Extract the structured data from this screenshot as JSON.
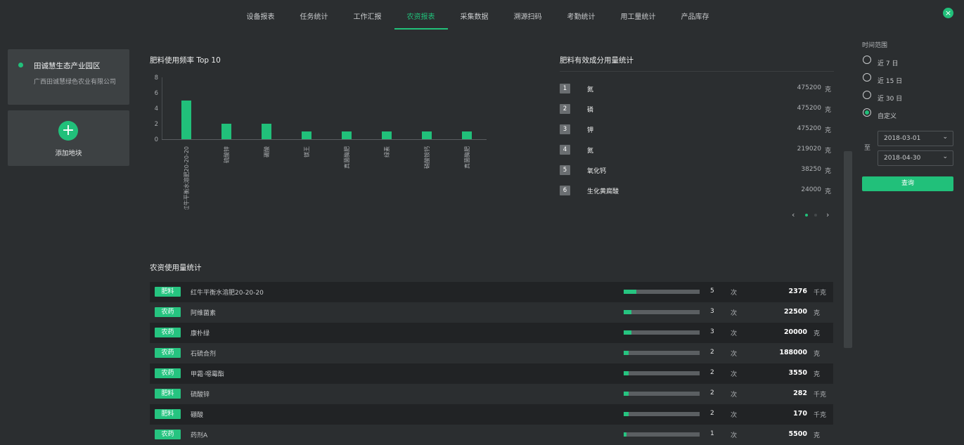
{
  "nav": {
    "tabs": [
      {
        "label": "设备报表"
      },
      {
        "label": "任务统计"
      },
      {
        "label": "工作汇报"
      },
      {
        "label": "农资报表"
      },
      {
        "label": "采集数据"
      },
      {
        "label": "溯源扫码"
      },
      {
        "label": "考勤统计"
      },
      {
        "label": "用工量统计"
      },
      {
        "label": "产品库存"
      }
    ],
    "active_index": 3,
    "close_icon": "×"
  },
  "sidebar": {
    "farm": {
      "name": "田诚慧生态产业园区",
      "company": "广西田诚慧绿色农业有限公司"
    },
    "add_label": "添加地块",
    "add_icon": "+"
  },
  "bar_section": {
    "title": "肥料使用频率 Top 10"
  },
  "chart_data": {
    "type": "bar",
    "categories": [
      "红牛平衡水溶肥20-20-20",
      "硫酸锌",
      "硼酸",
      "镁王",
      "真菌酶肥",
      "绿素",
      "硝酸铵钙",
      "真菌酶肥"
    ],
    "values": [
      5,
      2,
      2,
      1,
      1,
      1,
      1,
      1
    ],
    "ylim": [
      0,
      8
    ],
    "yticks": [
      0,
      2,
      4,
      6,
      8
    ],
    "bar_color": "#21c07a"
  },
  "rank_section": {
    "title": "肥料有效成分用量统计",
    "items": [
      {
        "rank": "1",
        "name": "氮",
        "value": "475200",
        "unit": "克"
      },
      {
        "rank": "2",
        "name": "磷",
        "value": "475200",
        "unit": "克"
      },
      {
        "rank": "3",
        "name": "钾",
        "value": "475200",
        "unit": "克"
      },
      {
        "rank": "4",
        "name": "氮",
        "value": "219020",
        "unit": "克"
      },
      {
        "rank": "5",
        "name": "氧化钙",
        "value": "38250",
        "unit": "克"
      },
      {
        "rank": "6",
        "name": "生化黄腐酸",
        "value": "24000",
        "unit": "克"
      }
    ],
    "prev_icon": "‹",
    "next_icon": "›"
  },
  "usage_section": {
    "title": "农资使用量统计",
    "times_label": "次",
    "max_count": 30,
    "rows": [
      {
        "tag": "肥料",
        "name": "红牛平衡水溶肥20-20-20",
        "count": 5,
        "amount": "2376",
        "unit": "千克"
      },
      {
        "tag": "农药",
        "name": "阿维菌素",
        "count": 3,
        "amount": "22500",
        "unit": "克"
      },
      {
        "tag": "农药",
        "name": "康朴绿",
        "count": 3,
        "amount": "20000",
        "unit": "克"
      },
      {
        "tag": "农药",
        "name": "石硫合剂",
        "count": 2,
        "amount": "188000",
        "unit": "克"
      },
      {
        "tag": "农药",
        "name": "甲霜·噁霉酯",
        "count": 2,
        "amount": "3550",
        "unit": "克"
      },
      {
        "tag": "肥料",
        "name": "硫酸锌",
        "count": 2,
        "amount": "282",
        "unit": "千克"
      },
      {
        "tag": "肥料",
        "name": "硼酸",
        "count": 2,
        "amount": "170",
        "unit": "千克"
      },
      {
        "tag": "农药",
        "name": "药剂A",
        "count": 1,
        "amount": "5500",
        "unit": "克"
      }
    ]
  },
  "filter": {
    "title": "时间范围",
    "options": [
      {
        "label": "近 7 日",
        "checked": false
      },
      {
        "label": "近 15 日",
        "checked": false
      },
      {
        "label": "近 30 日",
        "checked": false
      },
      {
        "label": "自定义",
        "checked": true
      }
    ],
    "to_label": "至",
    "start_date": "2018-03-01",
    "end_date": "2018-04-30",
    "query_label": "查询",
    "chevron_icon": "⌄"
  },
  "colors": {
    "accent": "#21c07a",
    "background": "#2b2e30",
    "card": "#3d4143"
  }
}
